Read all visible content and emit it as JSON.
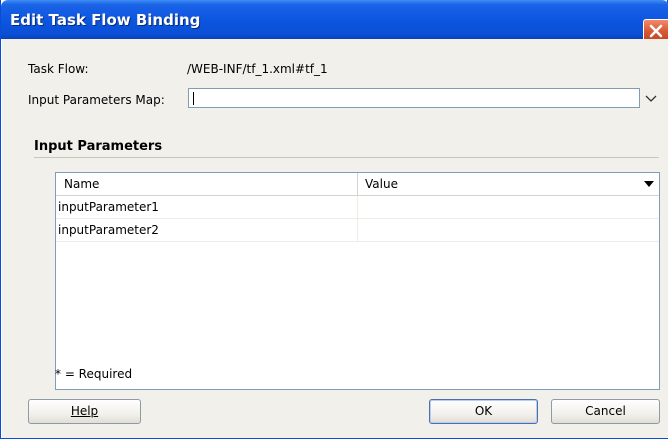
{
  "window": {
    "title": "Edit Task Flow Binding"
  },
  "form": {
    "task_flow_label": "Task Flow:",
    "task_flow_value": "/WEB-INF/tf_1.xml#tf_1",
    "input_map_label": "Input Parameters Map:",
    "input_map_value": ""
  },
  "section": {
    "title": "Input Parameters"
  },
  "table": {
    "columns": [
      "Name",
      "Value"
    ],
    "rows": [
      {
        "name": "inputParameter1",
        "value": ""
      },
      {
        "name": "inputParameter2",
        "value": ""
      }
    ]
  },
  "required_note": "* = Required",
  "buttons": {
    "help": "Help",
    "ok": "OK",
    "cancel": "Cancel"
  },
  "colors": {
    "titlebar": "#0d56e0",
    "close": "#d85a35",
    "dialog_bg": "#f1f0eb"
  },
  "icons": {
    "close": "close-icon",
    "dropdown": "chevron-down-icon",
    "column_menu": "triangle-down-icon"
  }
}
